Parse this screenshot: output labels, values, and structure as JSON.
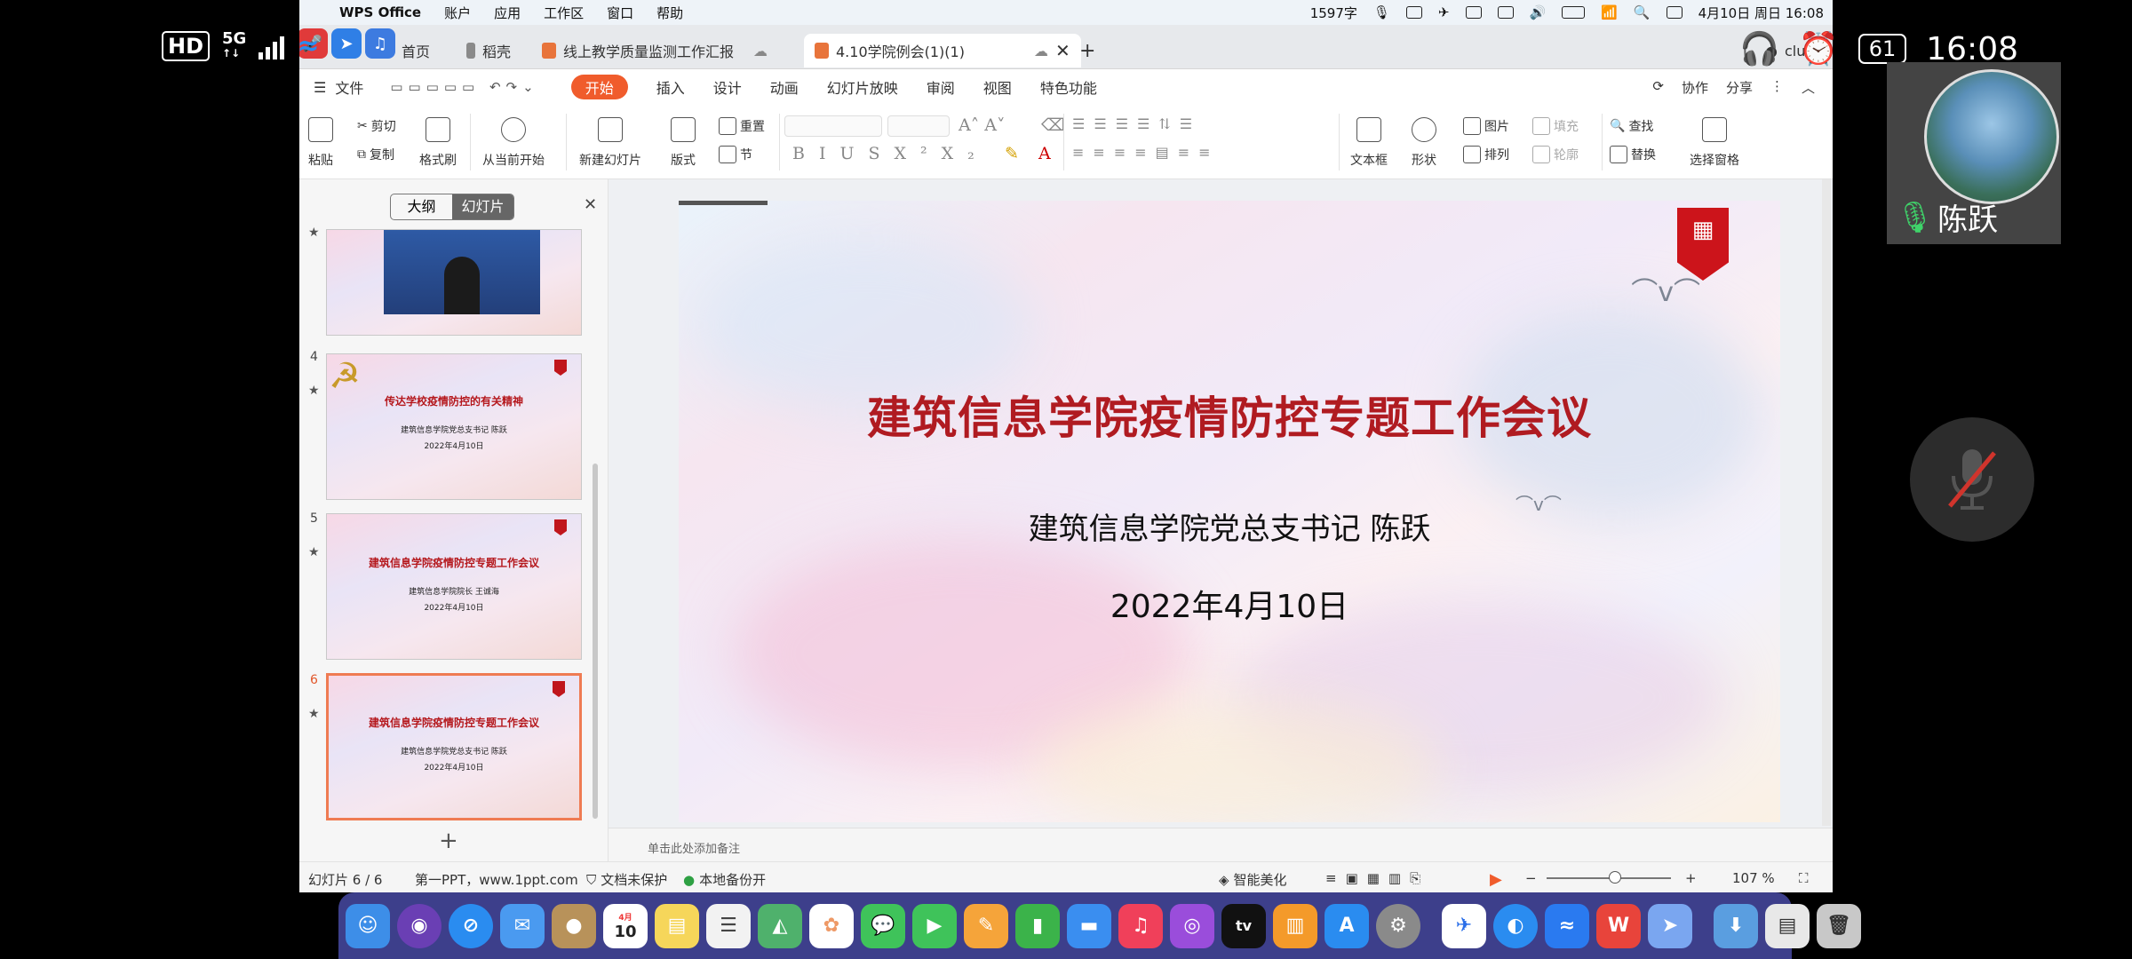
{
  "phone_status": {
    "hd": "HD",
    "network": "5G",
    "time": "16:08",
    "battery": "61"
  },
  "menubar": {
    "app_name": "WPS Office",
    "menus": [
      "账户",
      "应用",
      "工作区",
      "窗口",
      "帮助"
    ],
    "word_count": "1597字",
    "date_time": "4月10日 周日 16:08"
  },
  "tabs": {
    "home": "首页",
    "tab1": "稻壳",
    "tab2": "线上教学质量监测工作汇报",
    "tab3_active": "4.10学院例会(1)(1)",
    "user": "clup"
  },
  "ribbon_menu": {
    "file": "文件",
    "items": [
      "开始",
      "插入",
      "设计",
      "动画",
      "幻灯片放映",
      "审阅",
      "视图",
      "特色功能"
    ],
    "collab": "协作",
    "share": "分享"
  },
  "toolbar": {
    "paste": "粘贴",
    "cut": "剪切",
    "copy": "复制",
    "format_painter": "格式刷",
    "from_current": "从当前开始",
    "new_slide": "新建幻灯片",
    "layout": "版式",
    "reset": "重置",
    "section": "节",
    "textbox": "文本框",
    "shape": "形状",
    "picture": "图片",
    "arrange": "排列",
    "fill": "填充",
    "outline": "轮廓",
    "find": "查找",
    "replace": "替换",
    "select_pane": "选择窗格"
  },
  "sidebar": {
    "outline_tab": "大纲",
    "slides_tab": "幻灯片",
    "thumbs": [
      {
        "num": "4",
        "title": "传达学校疫情防控的有关精神",
        "sub": "建筑信息学院党总支书记  陈跃",
        "date": "2022年4月10日"
      },
      {
        "num": "5",
        "title": "建筑信息学院疫情防控专题工作会议",
        "sub": "建筑信息学院院长  王诚海",
        "date": "2022年4月10日"
      },
      {
        "num": "6",
        "title": "建筑信息学院疫情防控专题工作会议",
        "sub": "建筑信息学院党总支书记  陈跃",
        "date": "2022年4月10日"
      }
    ]
  },
  "slide": {
    "title": "建筑信息学院疫情防控专题工作会议",
    "subtitle": "建筑信息学院党总支书记    陈跃",
    "date": "2022年4月10日"
  },
  "notes_placeholder": "单击此处添加备注",
  "statusbar": {
    "slide_count": "幻灯片 6 / 6",
    "theme": "第一PPT，www.1ppt.com",
    "protect": "文档未保护",
    "backup": "本地备份开",
    "beautify": "智能美化",
    "zoom": "107 %"
  },
  "dock": {
    "calendar_month": "4月",
    "calendar_day": "10"
  },
  "call": {
    "caller_name": "陈跃"
  }
}
